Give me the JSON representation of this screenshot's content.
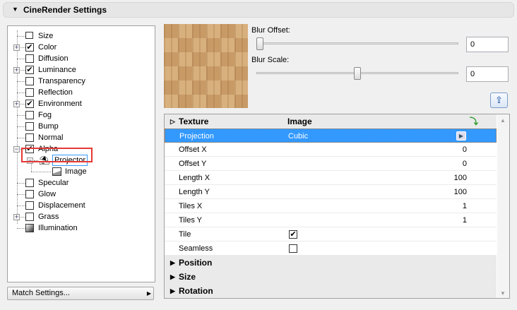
{
  "header": {
    "title": "CineRender Settings"
  },
  "tree": {
    "items": [
      {
        "label": "Size",
        "checkbox": false,
        "expander": null,
        "checked": false
      },
      {
        "label": "Color",
        "checkbox": true,
        "expander": "+",
        "checked": true
      },
      {
        "label": "Diffusion",
        "checkbox": true,
        "expander": null,
        "checked": false
      },
      {
        "label": "Luminance",
        "checkbox": true,
        "expander": "+",
        "checked": true
      },
      {
        "label": "Transparency",
        "checkbox": true,
        "expander": null,
        "checked": false
      },
      {
        "label": "Reflection",
        "checkbox": true,
        "expander": null,
        "checked": false
      },
      {
        "label": "Environment",
        "checkbox": true,
        "expander": "+",
        "checked": true
      },
      {
        "label": "Fog",
        "checkbox": true,
        "expander": null,
        "checked": false
      },
      {
        "label": "Bump",
        "checkbox": true,
        "expander": null,
        "checked": false
      },
      {
        "label": "Normal",
        "checkbox": true,
        "expander": null,
        "checked": false
      },
      {
        "label": "Alpha",
        "checkbox": true,
        "expander": "-",
        "checked": true
      },
      {
        "label": "Projector",
        "level": 1
      },
      {
        "label": "Image",
        "level": 2
      },
      {
        "label": "Specular",
        "checkbox": true,
        "expander": null,
        "checked": false
      },
      {
        "label": "Glow",
        "checkbox": true,
        "expander": null,
        "checked": false
      },
      {
        "label": "Displacement",
        "checkbox": true,
        "expander": null,
        "checked": false
      },
      {
        "label": "Grass",
        "checkbox": true,
        "expander": "+",
        "checked": false
      },
      {
        "label": "Illumination",
        "checkbox": false,
        "expander": null,
        "checked": false
      }
    ]
  },
  "match_settings": "Match Settings...",
  "blur_offset": {
    "label": "Blur Offset:",
    "value": "0",
    "slider": 0
  },
  "blur_scale": {
    "label": "Blur Scale:",
    "value": "0",
    "slider": 0.5
  },
  "table": {
    "header": {
      "name": "Texture",
      "value": "Image"
    },
    "rows": [
      {
        "name": "Projection",
        "value": "Cubic",
        "right": ""
      },
      {
        "name": "Offset X",
        "value": "",
        "right": "0"
      },
      {
        "name": "Offset Y",
        "value": "",
        "right": "0"
      },
      {
        "name": "Length X",
        "value": "",
        "right": "100"
      },
      {
        "name": "Length Y",
        "value": "",
        "right": "100"
      },
      {
        "name": "Tiles X",
        "value": "",
        "right": "1"
      },
      {
        "name": "Tiles Y",
        "value": "",
        "right": "1"
      },
      {
        "name": "Tile",
        "value": "",
        "right": "",
        "check": true
      },
      {
        "name": "Seamless",
        "value": "",
        "right": "",
        "check": false
      }
    ],
    "groups": [
      "Position",
      "Size",
      "Rotation"
    ]
  }
}
